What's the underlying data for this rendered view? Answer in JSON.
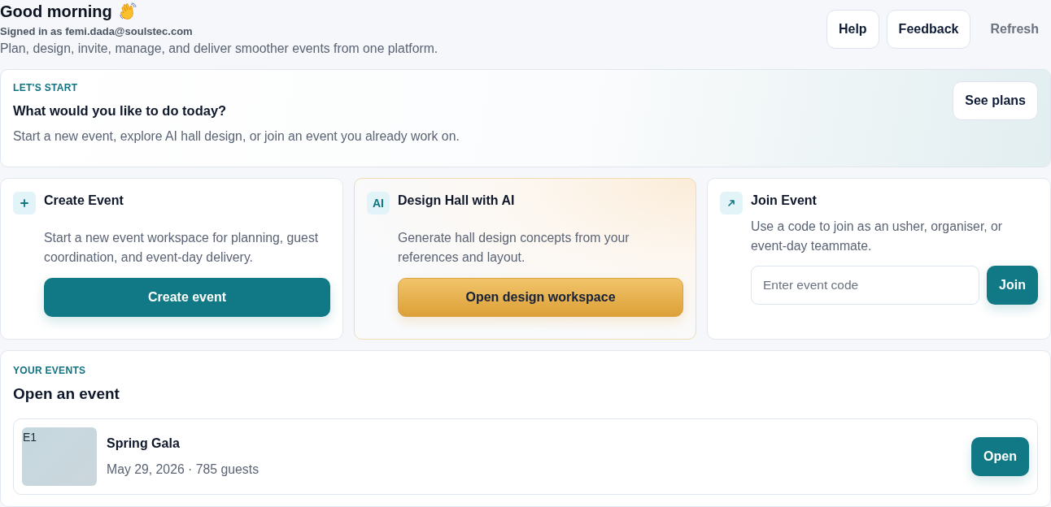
{
  "header": {
    "greeting": "Good morning",
    "signed_in": "Signed in as femi.dada@soulstec.com",
    "tagline": "Plan, design, invite, manage, and deliver smoother events from one platform.",
    "actions": [
      {
        "label": "Help",
        "kind": "outlined"
      },
      {
        "label": "Feedback",
        "kind": "outlined"
      },
      {
        "label": "Refresh",
        "kind": "plain"
      }
    ]
  },
  "hero": {
    "eyebrow": "LET'S START",
    "title": "What would you like to do today?",
    "subtitle": "Start a new event, explore AI hall design, or join an event you already work on.",
    "button": "See plans"
  },
  "action_cards": [
    {
      "kind": "create",
      "title": "Create Event",
      "description": "Start a new event workspace for planning, guest coordination, and event-day delivery.",
      "button": "Create event"
    },
    {
      "kind": "design",
      "badge": "AI",
      "title": "Design Hall with AI",
      "description": "Generate hall design concepts from your references and layout.",
      "button": "Open design workspace"
    },
    {
      "kind": "join",
      "title": "Join Event",
      "description": "Use a code to join as an usher, organiser, or event-day teammate.",
      "placeholder": "Enter event code",
      "button": "Join"
    }
  ],
  "events": {
    "eyebrow": "YOUR EVENTS",
    "title": "Open an event",
    "items": [
      {
        "thumbnail_label": "E1",
        "name": "Spring Gala",
        "meta": "May 29, 2026 · 785 guests",
        "button": "Open"
      }
    ]
  }
}
